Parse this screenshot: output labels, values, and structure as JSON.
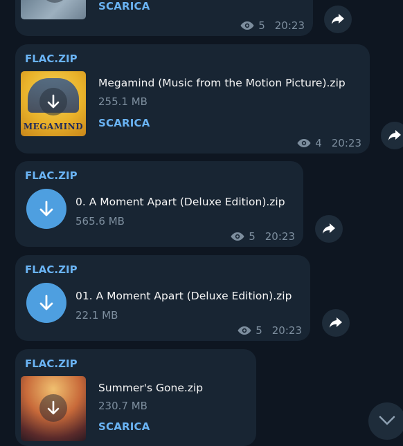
{
  "messages": [
    {
      "download_label": "SCARICA",
      "views": "5",
      "time": "20:23"
    },
    {
      "sender": "FLAC.ZIP",
      "file_name": "Megamind (Music from the Motion Picture).zip",
      "file_size": "255.1 MB",
      "download_label": "SCARICA",
      "views": "4",
      "time": "20:23",
      "cover_title": "MEGAMIND"
    },
    {
      "sender": "FLAC.ZIP",
      "file_name": "0. A Moment Apart (Deluxe Edition).zip",
      "file_size": "565.6 MB",
      "views": "5",
      "time": "20:23"
    },
    {
      "sender": "FLAC.ZIP",
      "file_name": "01. A Moment Apart (Deluxe Edition).zip",
      "file_size": "22.1 MB",
      "views": "5",
      "time": "20:23"
    },
    {
      "sender": "FLAC.ZIP",
      "file_name": "Summer's Gone.zip",
      "file_size": "230.7 MB",
      "download_label": "SCARICA"
    }
  ],
  "icons": {
    "views": "eye-icon",
    "share": "share-arrow-icon",
    "download": "download-arrow-icon",
    "scroll": "chevron-down-icon"
  },
  "colors": {
    "background": "#0e1621",
    "bubble": "#182533",
    "accent": "#6ab3f3",
    "download_circle": "#4e9fe0",
    "muted_text": "#7d8e9e"
  }
}
